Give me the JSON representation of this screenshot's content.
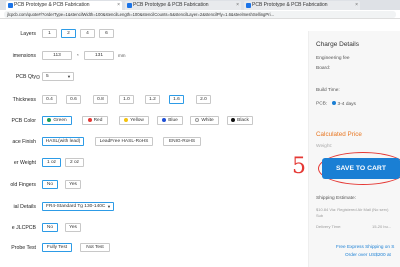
{
  "browser": {
    "tabs": [
      {
        "title": "PCB Prototype & PCB Fabrication",
        "close": "×"
      },
      {
        "title": "PCB Prototype & PCB Fabrication",
        "close": "×"
      },
      {
        "title": "PCB Prototype & PCB Fabrication",
        "close": "×"
      }
    ],
    "url": "jlcpcb.com/quote#/?orderType=1&stencilWidth=100&stencilLength=100&stencilCounts=5&stencilLayer=2&stencilPly=1.6&steelmeshSellingPri..."
  },
  "form": {
    "layers": {
      "label": "Layers",
      "options": [
        "1",
        "2",
        "4",
        "6"
      ]
    },
    "dimensions": {
      "label": "imensions",
      "width": "113",
      "height": "131",
      "sep": "*",
      "unit": "mm"
    },
    "pcb_qty": {
      "label": "PCB Qty",
      "value": "5",
      "caret": "▼"
    },
    "thickness": {
      "label": "Thickness",
      "options": [
        "0.4",
        "0.6",
        "0.8",
        "1.0",
        "1.2",
        "1.6",
        "2.0"
      ]
    },
    "pcb_color": {
      "label": "PCB Color",
      "options": [
        "Green",
        "Red",
        "Yellow",
        "Blue",
        "White",
        "Black"
      ]
    },
    "surface_finish": {
      "label": "ace Finish",
      "options": [
        "HASL(with lead)",
        "LeadFree HASL-RoHS",
        "ENIG-RoHS"
      ]
    },
    "copper_weight": {
      "label": "er Weight",
      "options": [
        "1 oz",
        "2 oz"
      ]
    },
    "gold_fingers": {
      "label": "old Fingers",
      "options": [
        "No",
        "Yes"
      ]
    },
    "material": {
      "label": "ial Details",
      "value": "FR4-Standard Tg 130-140C",
      "caret": "▼"
    },
    "remove_order": {
      "label": "e JLCPCB",
      "options": [
        "No",
        "Yes"
      ]
    },
    "flying_probe": {
      "label": "Probe Test",
      "options": [
        "Fully Test",
        "Not Test"
      ]
    }
  },
  "panel": {
    "title": "Charge Details",
    "engineering_fee": "Engineering fee",
    "board": "Board:",
    "build_time": "Build Time:",
    "pcb_build": "PCB:",
    "pcb_build_option": "3-4 days",
    "calculated_price": "Calculated Price",
    "weight": "Weight:",
    "save_button": "SAVE TO CART",
    "shipping_estimate": "Shipping Estimate:",
    "shipping_line1": "$10.84  Via: Registered Air Mail (No serv)",
    "shipping_line2": "Sub",
    "delivery_time": "Delivery Time:",
    "delivery_value": "15-20 bu...",
    "free_shipping": "Free Express Shipping on S",
    "free_shipping2": "Order over US$200 at"
  },
  "annotation": {
    "number": "5"
  },
  "colors": {
    "accent": "#2d9be6",
    "save_button": "#1a7fd4",
    "price": "#e87722",
    "annotation": "#e53935",
    "pcb_colors": {
      "Green": "#1f9d55",
      "Red": "#e53935",
      "Yellow": "#f4c20d",
      "Blue": "#1e4fd6",
      "White": "#ffffff",
      "Black": "#111111"
    }
  }
}
